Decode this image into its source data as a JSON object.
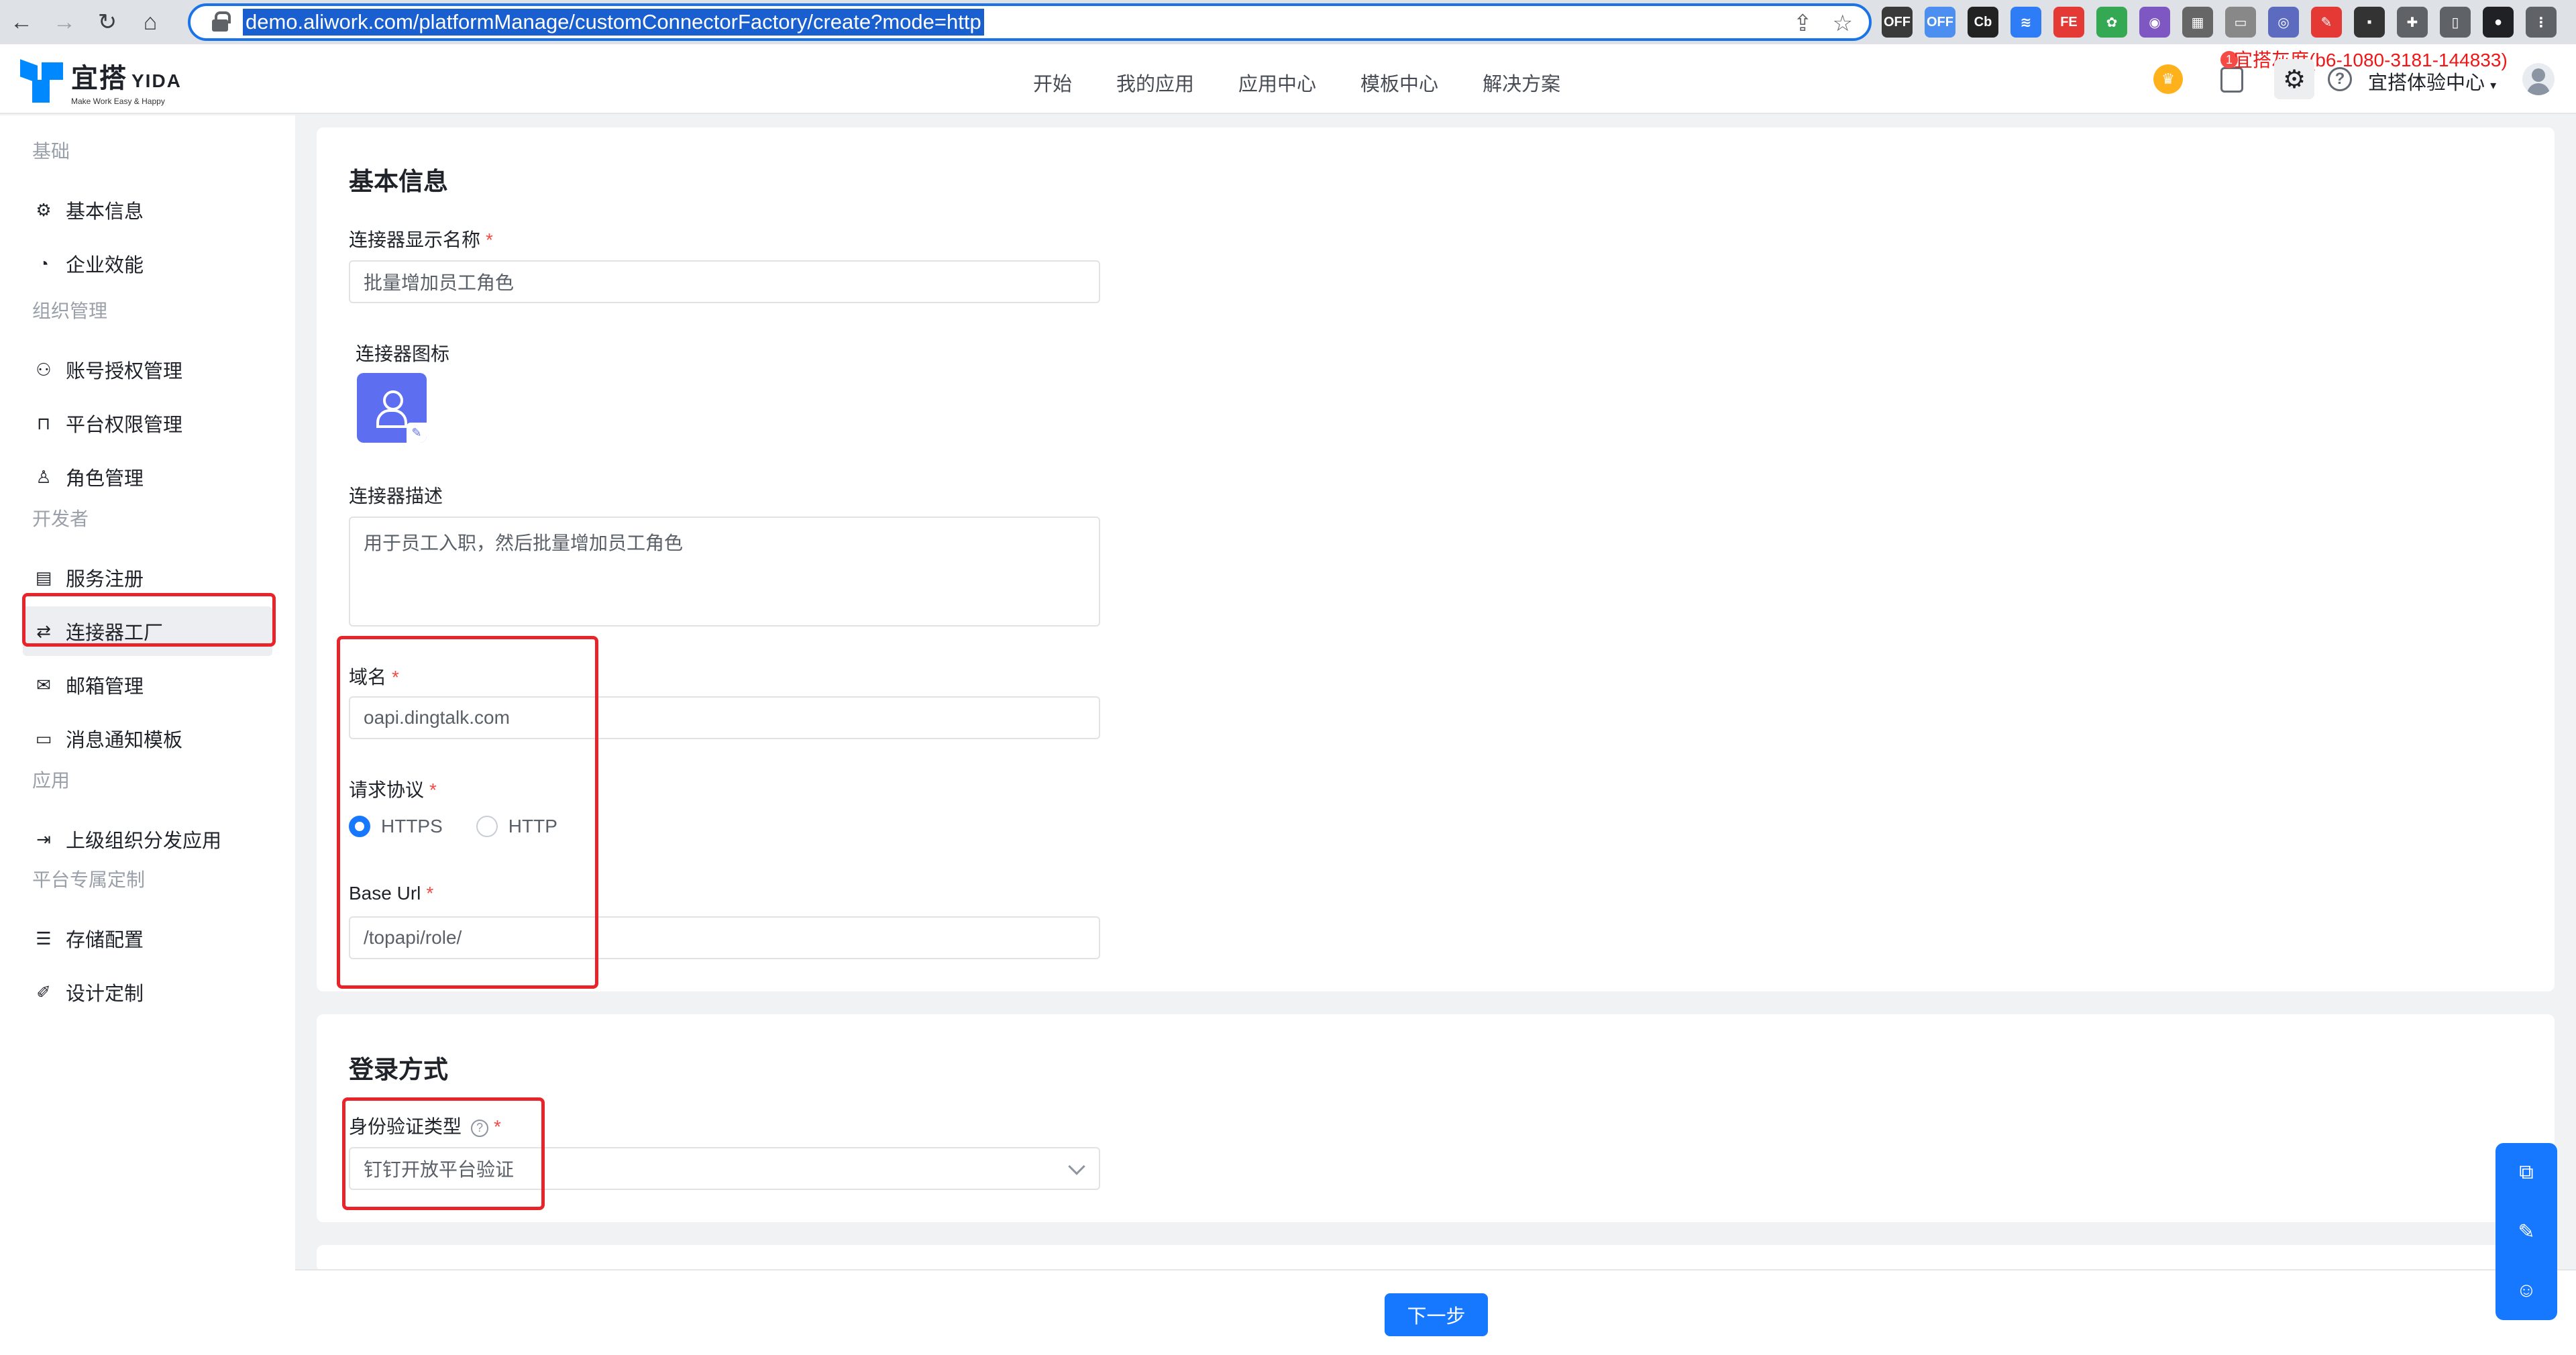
{
  "browser": {
    "url": "demo.aliwork.com/platformManage/customConnectorFactory/create?mode=http",
    "extensions": [
      {
        "name": "off-extension-1",
        "label": "OFF",
        "color": "#3a3a3a"
      },
      {
        "name": "off-extension-2",
        "label": "OFF",
        "color": "#4d8ff0"
      },
      {
        "name": "cb-extension",
        "label": "Cb",
        "color": "#222"
      },
      {
        "name": "double-chevron-extension",
        "label": "≋",
        "color": "#2f7df6"
      },
      {
        "name": "fe-extension",
        "label": "FE",
        "color": "#e53935"
      },
      {
        "name": "green-gear-extension",
        "label": "✿",
        "color": "#34a853"
      },
      {
        "name": "chrome-color-extension",
        "label": "◉",
        "color": "#7e57c2"
      },
      {
        "name": "qr-extension",
        "label": "▦",
        "color": "#666"
      },
      {
        "name": "card-extension",
        "label": "▭",
        "color": "#888"
      },
      {
        "name": "circle-extension",
        "label": "◎",
        "color": "#5c6bc0"
      },
      {
        "name": "pen-extension",
        "label": "✎",
        "color": "#e53935"
      },
      {
        "name": "dark-extension",
        "label": "▪",
        "color": "#333"
      },
      {
        "name": "puzzle-extension",
        "label": "✚",
        "color": "#5f6368"
      },
      {
        "name": "sidepanel-extension",
        "label": "▯",
        "color": "#5f6368"
      },
      {
        "name": "profile-extension",
        "label": "●",
        "color": "#202124"
      },
      {
        "name": "menu-extension",
        "label": "⋮",
        "color": "#5f6368"
      }
    ]
  },
  "header": {
    "logo_title": "宜搭",
    "logo_title_en": "YIDA",
    "logo_subtitle": "Make Work Easy & Happy",
    "nav": [
      "开始",
      "我的应用",
      "应用中心",
      "模板中心",
      "解决方案"
    ],
    "badge_count": "1",
    "gray_tag": "宜搭灰度(b6-1080-3181-144833)",
    "org_name": "宜搭体验中心"
  },
  "sidebar": {
    "groups": [
      {
        "label": "基础",
        "items": [
          {
            "label": "基本信息",
            "icon": "gear-icon"
          },
          {
            "label": "企业效能",
            "icon": "pie-chart-icon"
          }
        ]
      },
      {
        "label": "组织管理",
        "items": [
          {
            "label": "账号授权管理",
            "icon": "users-icon"
          },
          {
            "label": "平台权限管理",
            "icon": "lock-icon"
          },
          {
            "label": "角色管理",
            "icon": "user-role-icon"
          }
        ]
      },
      {
        "label": "开发者",
        "items": [
          {
            "label": "服务注册",
            "icon": "document-icon"
          },
          {
            "label": "连接器工厂",
            "icon": "connector-icon"
          },
          {
            "label": "邮箱管理",
            "icon": "mail-icon"
          },
          {
            "label": "消息通知模板",
            "icon": "message-icon"
          }
        ]
      },
      {
        "label": "应用",
        "items": [
          {
            "label": "上级组织分发应用",
            "icon": "login-icon"
          }
        ]
      },
      {
        "label": "平台专属定制",
        "items": [
          {
            "label": "存储配置",
            "icon": "database-icon"
          },
          {
            "label": "设计定制",
            "icon": "brush-icon"
          }
        ]
      }
    ]
  },
  "basic_info": {
    "title": "基本信息",
    "name_label": "连接器显示名称",
    "name_value": "批量增加员工角色",
    "icon_label": "连接器图标",
    "desc_label": "连接器描述",
    "desc_value": "用于员工入职，然后批量增加员工角色",
    "domain_label": "域名",
    "domain_value": "oapi.dingtalk.com",
    "protocol_label": "请求协议",
    "protocol_options": [
      "HTTPS",
      "HTTP"
    ],
    "protocol_selected": "HTTPS",
    "baseurl_label": "Base Url",
    "baseurl_value": "/topapi/role/"
  },
  "login": {
    "title": "登录方式",
    "auth_label": "身份验证类型",
    "auth_value": "钉钉开放平台验证"
  },
  "footer": {
    "next_label": "下一步"
  },
  "required_mark": "*",
  "colors": {
    "primary": "#1677ff",
    "highlight_box": "#e8242a",
    "connector_icon_bg": "#5d6ef0"
  }
}
